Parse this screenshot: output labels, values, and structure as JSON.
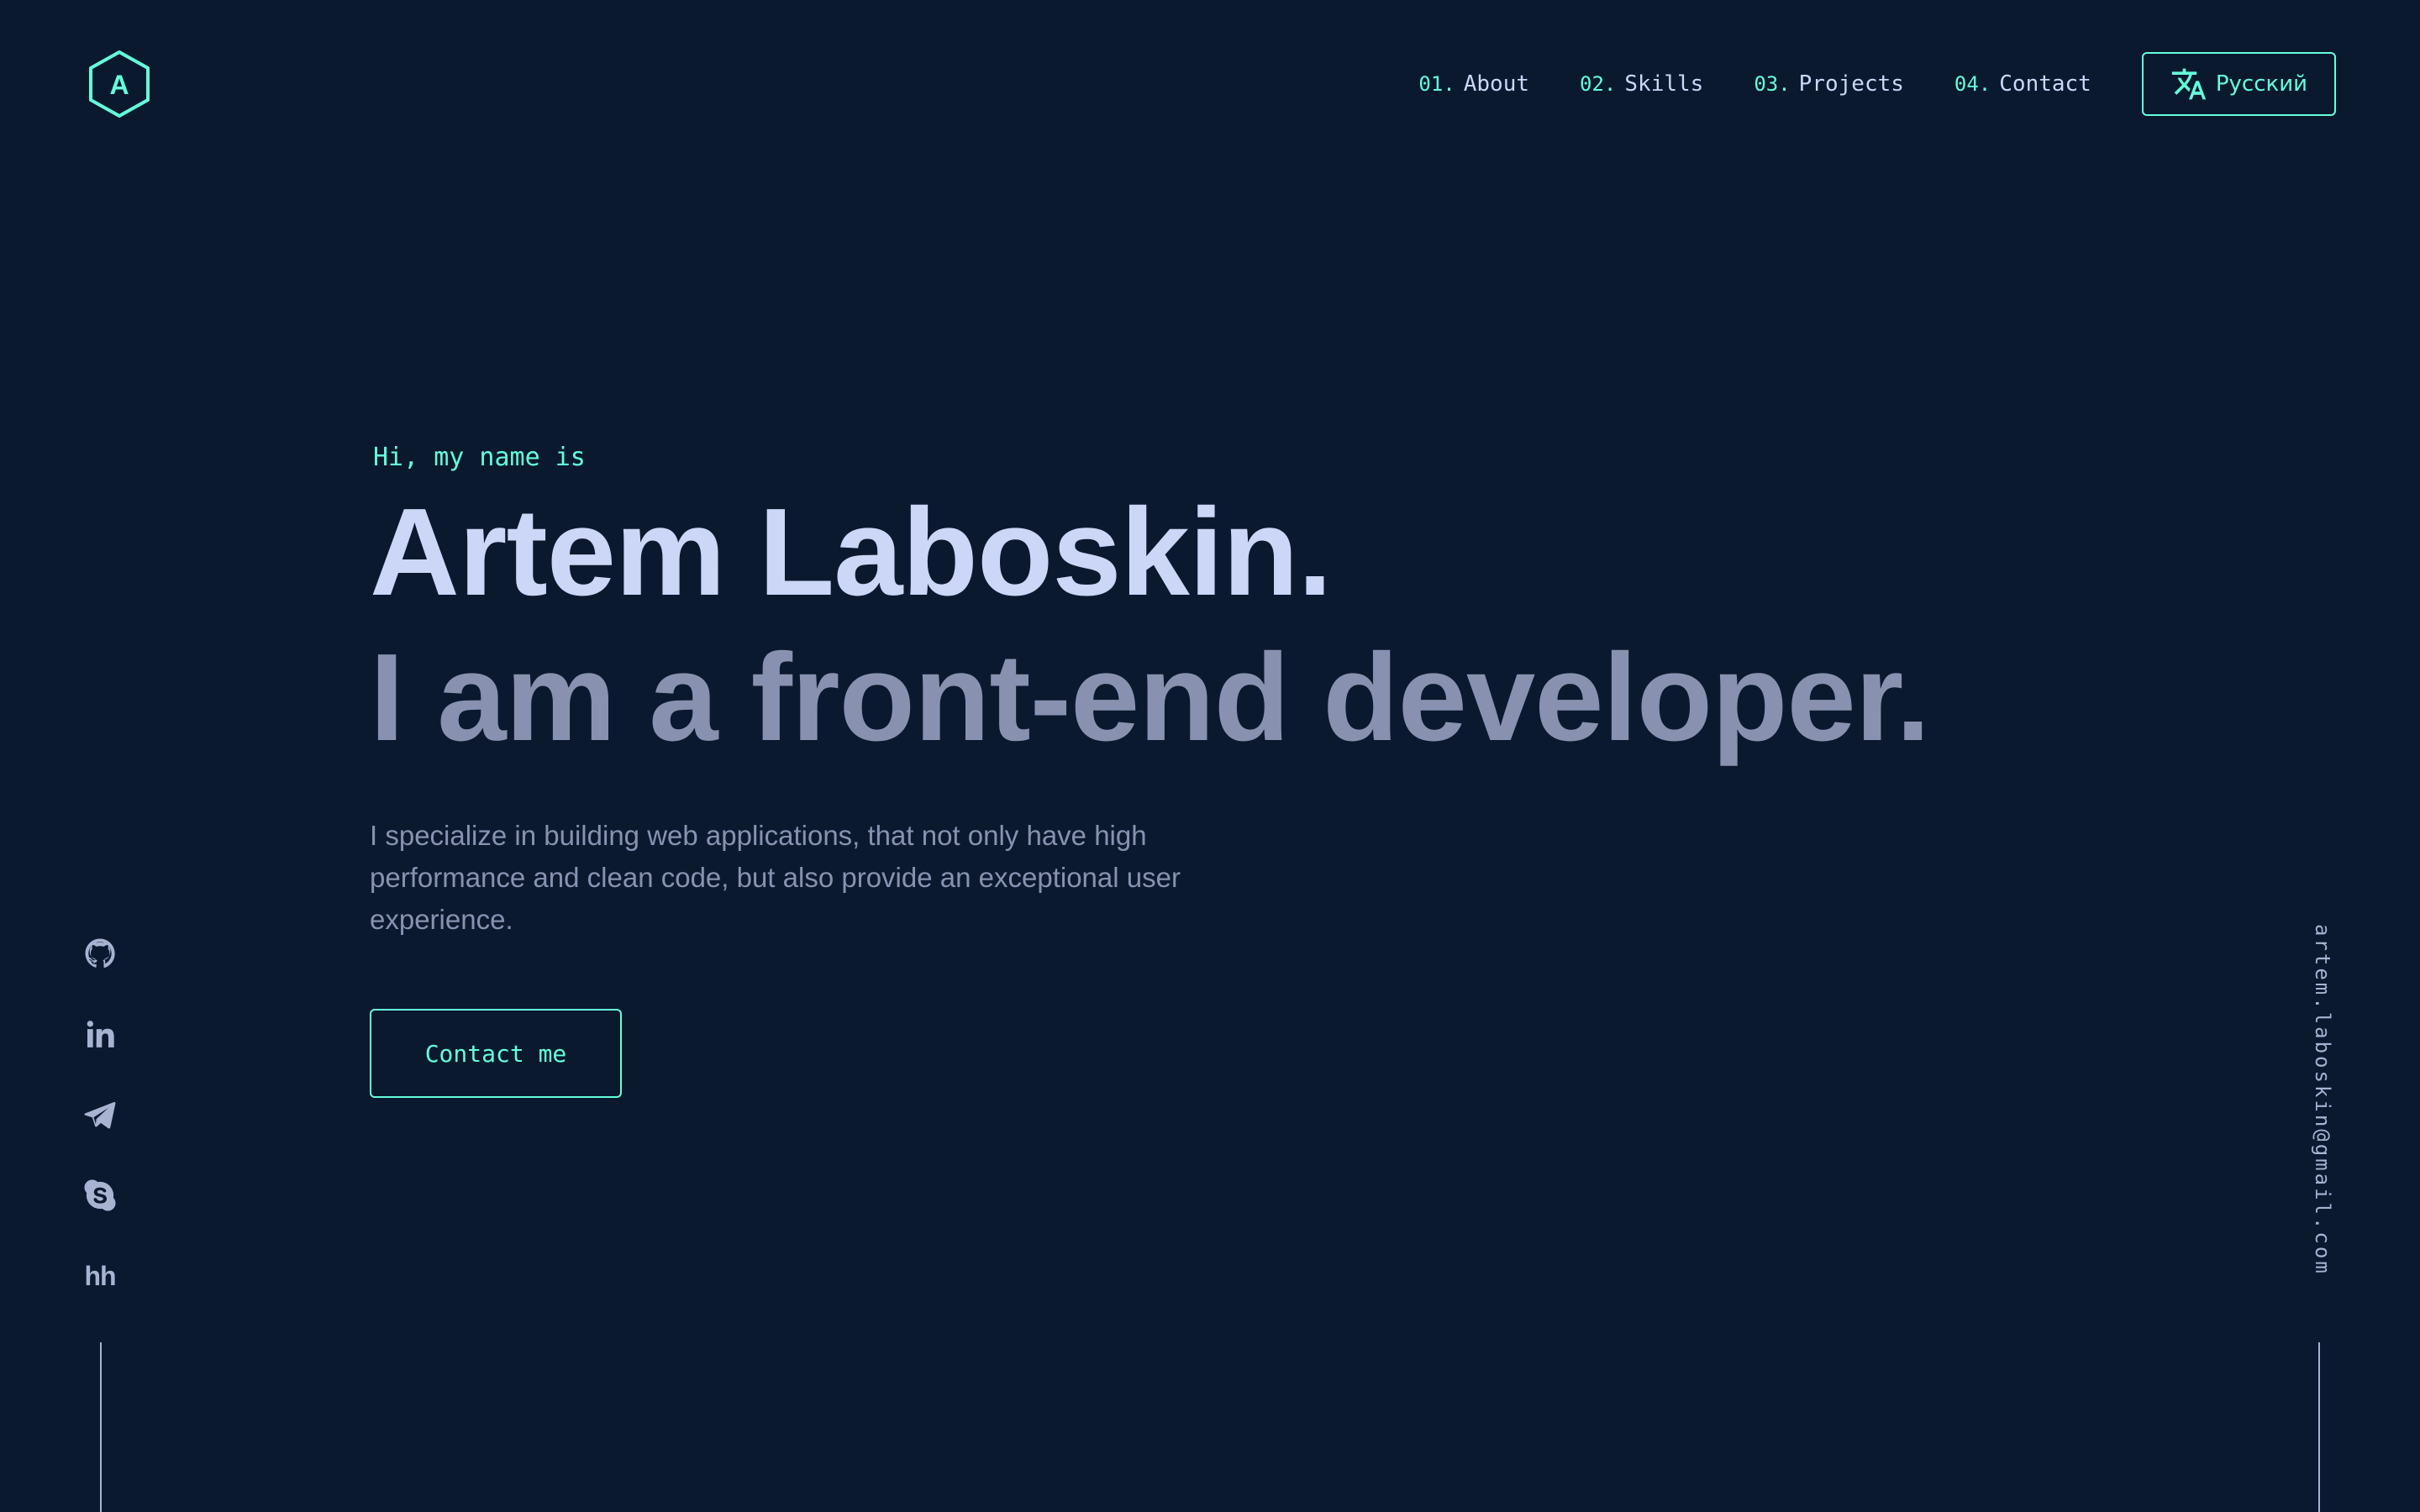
{
  "colors": {
    "background": "#0b192f",
    "accent": "#64ffda",
    "heading": "#ccd6f6",
    "muted": "#8892b0",
    "icon": "#a8b2d1"
  },
  "header": {
    "logo_letter": "A",
    "nav": [
      {
        "num": "01.",
        "label": "About"
      },
      {
        "num": "02.",
        "label": "Skills"
      },
      {
        "num": "03.",
        "label": "Projects"
      },
      {
        "num": "04.",
        "label": "Contact"
      }
    ],
    "language_button": {
      "icon": "translate-icon",
      "label": "Русский"
    }
  },
  "hero": {
    "greeting": "Hi, my name is",
    "name": "Artem Laboskin.",
    "role": "I am a front-end developer.",
    "description": "I specialize in building web applications, that not only have high performance and clean code, but also provide an exceptional user experience.",
    "cta_label": "Contact me"
  },
  "social": [
    {
      "icon": "github-icon"
    },
    {
      "icon": "linkedin-icon"
    },
    {
      "icon": "telegram-icon"
    },
    {
      "icon": "skype-icon"
    },
    {
      "icon": "hh-icon",
      "text": "hh"
    }
  ],
  "email": "artem.laboskin@gmail.com"
}
